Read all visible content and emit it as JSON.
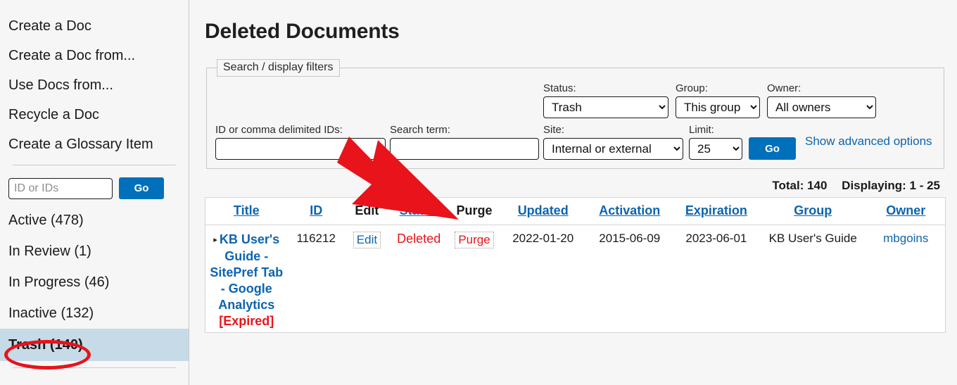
{
  "sidebar": {
    "actions": [
      {
        "label": "Create a Doc",
        "name": "create-a-doc"
      },
      {
        "label": "Create a Doc from...",
        "name": "create-a-doc-from"
      },
      {
        "label": "Use Docs from...",
        "name": "use-docs-from"
      },
      {
        "label": "Recycle a Doc",
        "name": "recycle-a-doc"
      },
      {
        "label": "Create a Glossary Item",
        "name": "create-a-glossary-item"
      }
    ],
    "id_lookup": {
      "placeholder": "ID or IDs",
      "value": "",
      "go_label": "Go"
    },
    "statuses": [
      {
        "label": "Active (478)",
        "name": "sidebar-item-active",
        "selected": false
      },
      {
        "label": "In Review (1)",
        "name": "sidebar-item-in-review",
        "selected": false
      },
      {
        "label": "In Progress (46)",
        "name": "sidebar-item-in-progress",
        "selected": false
      },
      {
        "label": "Inactive (132)",
        "name": "sidebar-item-inactive",
        "selected": false
      },
      {
        "label": "Trash (140)",
        "name": "sidebar-item-trash",
        "selected": true
      }
    ]
  },
  "main": {
    "page_title": "Deleted Documents",
    "filters": {
      "legend": "Search / display filters",
      "id_field": {
        "label": "ID or comma delimited IDs:",
        "value": "",
        "placeholder": ""
      },
      "search_field": {
        "label": "Search term:",
        "value": "",
        "placeholder": ""
      },
      "status": {
        "label": "Status:",
        "value": "Trash"
      },
      "group": {
        "label": "Group:",
        "value": "This group"
      },
      "owner": {
        "label": "Owner:",
        "value": "All owners"
      },
      "site": {
        "label": "Site:",
        "value": "Internal or external"
      },
      "limit": {
        "label": "Limit:",
        "value": "25"
      },
      "go_label": "Go",
      "advanced_link": "Show advanced options"
    },
    "totals": {
      "total": "Total: 140",
      "displaying": "Displaying: 1 - 25"
    },
    "table": {
      "columns": [
        {
          "label": "Title",
          "sortable": true,
          "name": "col-title"
        },
        {
          "label": "ID",
          "sortable": true,
          "name": "col-id"
        },
        {
          "label": "Edit",
          "sortable": false,
          "name": "col-edit"
        },
        {
          "label": "Status",
          "sortable": true,
          "name": "col-status"
        },
        {
          "label": "Purge",
          "sortable": false,
          "name": "col-purge"
        },
        {
          "label": "Updated",
          "sortable": true,
          "name": "col-updated"
        },
        {
          "label": "Activation",
          "sortable": true,
          "name": "col-activation"
        },
        {
          "label": "Expiration",
          "sortable": true,
          "name": "col-expiration"
        },
        {
          "label": "Group",
          "sortable": true,
          "name": "col-group"
        },
        {
          "label": "Owner",
          "sortable": true,
          "name": "col-owner"
        }
      ],
      "rows": [
        {
          "title": "KB User's Guide - SitePref Tab - Google Analytics",
          "title_suffix": "[Expired]",
          "id": "116212",
          "edit": "Edit",
          "status": "Deleted",
          "purge": "Purge",
          "updated": "2022-01-20",
          "activation": "2015-06-09",
          "expiration": "2023-06-01",
          "group": "KB User's Guide",
          "owner": "mbgoins"
        }
      ]
    }
  },
  "annotations": {
    "arrow_color": "#e8131b",
    "ellipse_color": "#e8131b"
  },
  "colors": {
    "accent_blue": "#0070bb",
    "link_blue": "#0c64b0",
    "alert_red": "#e8131b",
    "selected_bg": "#c6dbe7"
  }
}
